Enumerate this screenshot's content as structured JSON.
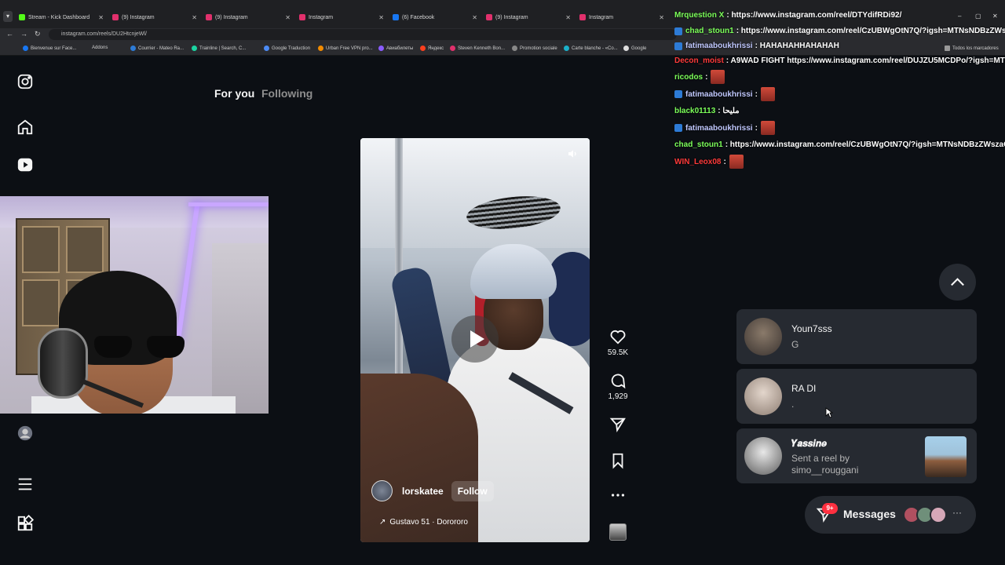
{
  "browser": {
    "tabs": [
      {
        "label": "Stream - Kick Dashboard",
        "color": "#53fc18"
      },
      {
        "label": "(9) Instagram",
        "color": "#e1306c"
      },
      {
        "label": "(9) Instagram",
        "color": "#e1306c"
      },
      {
        "label": "Instagram",
        "color": "#e1306c"
      },
      {
        "label": "(6) Facebook",
        "color": "#1877f2"
      },
      {
        "label": "(9) Instagram",
        "color": "#e1306c"
      },
      {
        "label": "Instagram",
        "color": "#e1306c"
      }
    ],
    "url": "instagram.com/reels/DU2HtcnjeWl/",
    "bookmarks": [
      "Bienvenue sur Face...",
      "Addons",
      "Courrier - Mateo Ra...",
      "Trainline | Search, C...",
      "Google Traduction",
      "Urban Free VPN pro...",
      "Авиабилеты",
      "Яндекс",
      "Steven Kenneth Bon...",
      "Promotion sociale",
      "Carte blanche - «Co...",
      "Google",
      "Todos los marcadores"
    ]
  },
  "feed_tabs": {
    "for_you": "For you",
    "following": "Following"
  },
  "reel": {
    "author": "lorskatee",
    "follow_label": "Follow",
    "audio": "Gustavo 51 · Dorororo",
    "likes": "59.5K",
    "comments": "1,929"
  },
  "chat": [
    {
      "user": "Mrquestion X",
      "msg": ": https://www.instagram.com/reel/DTYdifRDi92/",
      "color": "#7cff5a",
      "badge": false
    },
    {
      "user": "chad_stoun1",
      "msg": ": https://www.instagram.com/reel/CzUBWgOtN7Q/?igsh=MTNsNDBzZWszaGo5",
      "color": "#7cff5a",
      "badge": true
    },
    {
      "user": "fatimaaboukhrissi",
      "msg": ": HAHAHAHHAHAHAH",
      "color": "#c0c8ff",
      "badge": true
    },
    {
      "user": "Decon_moist",
      "msg": ": A9WAD FIGHT https://www.instagram.com/reel/DUJZU5MCDPo/?igsh=MTR6b",
      "color": "#ff3a3a",
      "badge": false
    },
    {
      "user": "ricodos",
      "msg": ":",
      "color": "#7cff5a",
      "badge": false,
      "emote": true
    },
    {
      "user": "fatimaaboukhrissi",
      "msg": ":",
      "color": "#c0c8ff",
      "badge": true,
      "emote": true
    },
    {
      "user": "black01113",
      "msg": ": مليحا",
      "color": "#7cff5a",
      "badge": false
    },
    {
      "user": "fatimaaboukhrissi",
      "msg": ":",
      "color": "#c0c8ff",
      "badge": true,
      "emote": true
    },
    {
      "user": "chad_stoun1",
      "msg": ": https://www.instagram.com/reel/CzUBWgOtN7Q/?igsh=MTNsNDBzZWszaGo5",
      "color": "#7cff5a",
      "badge": false
    },
    {
      "user": "WIN_Leox08",
      "msg": ":",
      "color": "#ff3a3a",
      "badge": false,
      "emote": true
    }
  ],
  "dms": [
    {
      "name": "Youn7sss",
      "preview": "G"
    },
    {
      "name": "RA DI",
      "preview": "."
    },
    {
      "name": "𝒀𝒂𝒔𝒔𝒊𝒏𝒆",
      "preview": "Sent a reel by",
      "preview2": "simo__rouggani"
    }
  ],
  "messages": {
    "label": "Messages",
    "badge": "9+"
  }
}
